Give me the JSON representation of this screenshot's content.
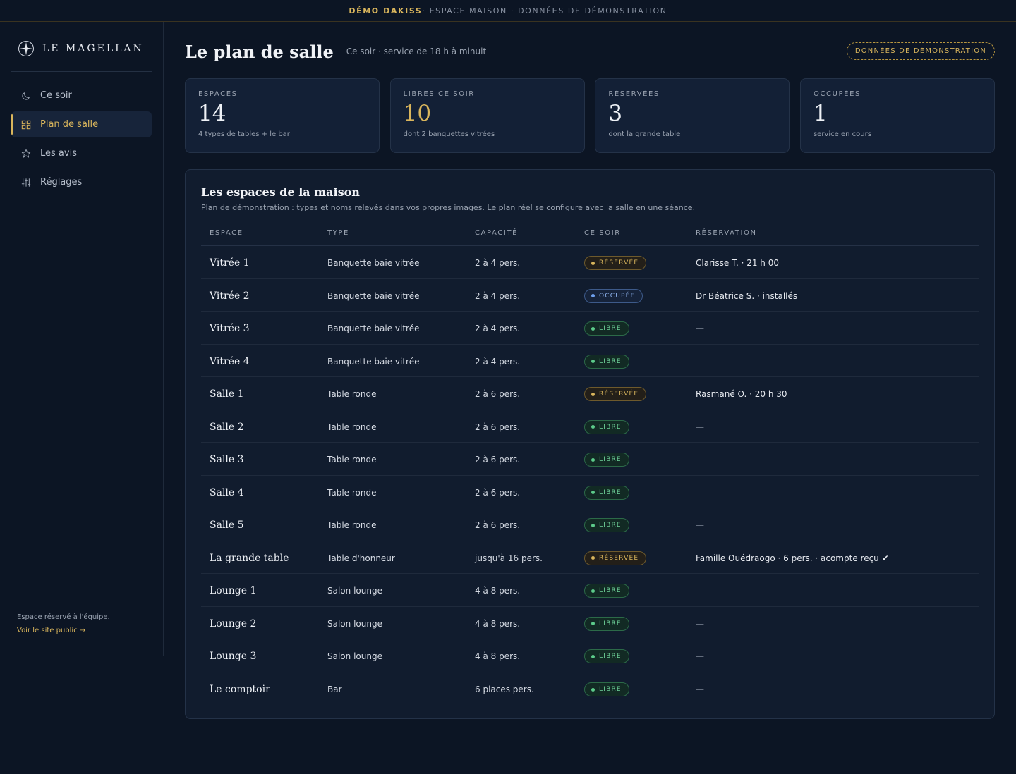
{
  "topbar": {
    "brand": "DÉMO DAKISS",
    "rest": " · ESPACE MAISON · DONNÉES DE DÉMONSTRATION"
  },
  "sidebar": {
    "logo_text": "LE MAGELLAN",
    "items": [
      {
        "label": "Ce soir",
        "icon": "moon-icon"
      },
      {
        "label": "Plan de salle",
        "icon": "grid-icon",
        "active": true
      },
      {
        "label": "Les avis",
        "icon": "star-icon"
      },
      {
        "label": "Réglages",
        "icon": "sliders-icon"
      }
    ],
    "footer_note": "Espace réservé à l'équipe.",
    "footer_link": "Voir le site public →"
  },
  "header": {
    "title": "Le plan de salle",
    "subtitle": "Ce soir · service de 18 h à minuit",
    "demo_badge": "DONNÉES DE DÉMONSTRATION"
  },
  "stats": [
    {
      "label": "ESPACES",
      "value": "14",
      "note": "4 types de tables + le bar"
    },
    {
      "label": "LIBRES CE SOIR",
      "value": "10",
      "note": "dont 2 banquettes vitrées"
    },
    {
      "label": "RÉSERVÉES",
      "value": "3",
      "note": "dont la grande table"
    },
    {
      "label": "OCCUPÉES",
      "value": "1",
      "note": "service en cours"
    }
  ],
  "panel": {
    "title": "Les espaces de la maison",
    "description": "Plan de démonstration : types et noms relevés dans vos propres images. Le plan réel se configure avec la salle en une séance.",
    "columns": [
      "ESPACE",
      "TYPE",
      "CAPACITÉ",
      "CE SOIR",
      "RÉSERVATION"
    ],
    "rows": [
      {
        "name": "Vitrée 1",
        "type": "Banquette baie vitrée",
        "capacity": "2 à 4 pers.",
        "status": "RÉSERVÉE",
        "kind": "reserved",
        "reservation": "Clarisse T. · 21 h 00"
      },
      {
        "name": "Vitrée 2",
        "type": "Banquette baie vitrée",
        "capacity": "2 à 4 pers.",
        "status": "OCCUPÉE",
        "kind": "occupied",
        "reservation": "Dr Béatrice S. · installés"
      },
      {
        "name": "Vitrée 3",
        "type": "Banquette baie vitrée",
        "capacity": "2 à 4 pers.",
        "status": "LIBRE",
        "kind": "free",
        "reservation": "—"
      },
      {
        "name": "Vitrée 4",
        "type": "Banquette baie vitrée",
        "capacity": "2 à 4 pers.",
        "status": "LIBRE",
        "kind": "free",
        "reservation": "—"
      },
      {
        "name": "Salle 1",
        "type": "Table ronde",
        "capacity": "2 à 6 pers.",
        "status": "RÉSERVÉE",
        "kind": "reserved",
        "reservation": "Rasmané O. · 20 h 30"
      },
      {
        "name": "Salle 2",
        "type": "Table ronde",
        "capacity": "2 à 6 pers.",
        "status": "LIBRE",
        "kind": "free",
        "reservation": "—"
      },
      {
        "name": "Salle 3",
        "type": "Table ronde",
        "capacity": "2 à 6 pers.",
        "status": "LIBRE",
        "kind": "free",
        "reservation": "—"
      },
      {
        "name": "Salle 4",
        "type": "Table ronde",
        "capacity": "2 à 6 pers.",
        "status": "LIBRE",
        "kind": "free",
        "reservation": "—"
      },
      {
        "name": "Salle 5",
        "type": "Table ronde",
        "capacity": "2 à 6 pers.",
        "status": "LIBRE",
        "kind": "free",
        "reservation": "—"
      },
      {
        "name": "La grande table",
        "type": "Table d'honneur",
        "capacity": "jusqu'à 16 pers.",
        "status": "RÉSERVÉE",
        "kind": "reserved",
        "reservation": "Famille Ouédraogo · 6 pers. · acompte reçu ✔"
      },
      {
        "name": "Lounge 1",
        "type": "Salon lounge",
        "capacity": "4 à 8 pers.",
        "status": "LIBRE",
        "kind": "free",
        "reservation": "—"
      },
      {
        "name": "Lounge 2",
        "type": "Salon lounge",
        "capacity": "4 à 8 pers.",
        "status": "LIBRE",
        "kind": "free",
        "reservation": "—"
      },
      {
        "name": "Lounge 3",
        "type": "Salon lounge",
        "capacity": "4 à 8 pers.",
        "status": "LIBRE",
        "kind": "free",
        "reservation": "—"
      },
      {
        "name": "Le comptoir",
        "type": "Bar",
        "capacity": "6 places pers.",
        "status": "LIBRE",
        "kind": "free",
        "reservation": "—"
      }
    ]
  }
}
